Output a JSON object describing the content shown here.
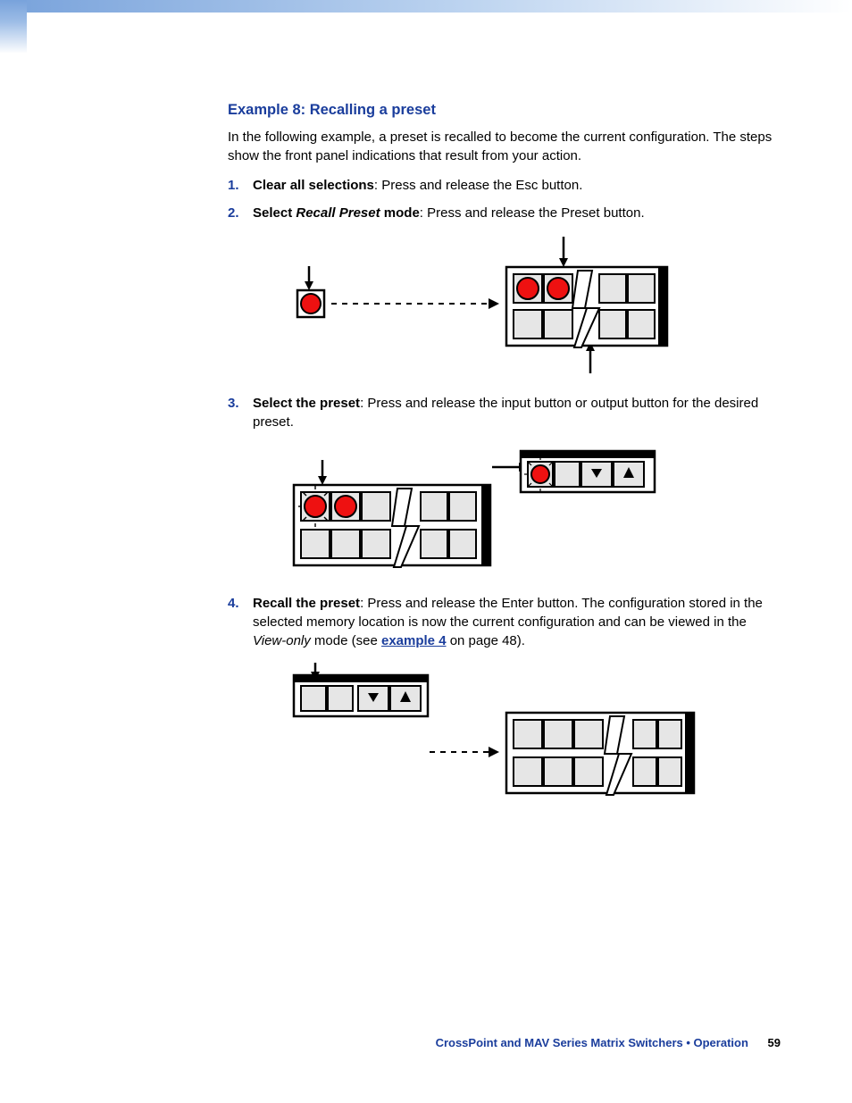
{
  "title": "Example 8: Recalling a preset",
  "intro": "In the following example, a preset is recalled to become the current configuration. The steps show the front panel indications that result from your action.",
  "steps": {
    "s1": {
      "lead": "Clear all selections",
      "rest": ": Press and release the Esc button."
    },
    "s2": {
      "lead_a": "Select ",
      "lead_b": "Recall Preset",
      "lead_c": " mode",
      "rest": ": Press and release the Preset button."
    },
    "s3": {
      "lead": "Select the preset",
      "rest": ": Press and release the input button or output button for the desired preset."
    },
    "s4": {
      "lead": "Recall the preset",
      "rest_a": ": Press and release the Enter button. The configuration stored in the selected memory location is now the current configuration and can be viewed in the ",
      "italic": "View-only",
      "rest_b": " mode (see ",
      "link": "example 4",
      "rest_c": " on page 48)."
    }
  },
  "footer": {
    "doc": "CrossPoint and MAV Series Matrix Switchers • Operation",
    "page": "59"
  }
}
